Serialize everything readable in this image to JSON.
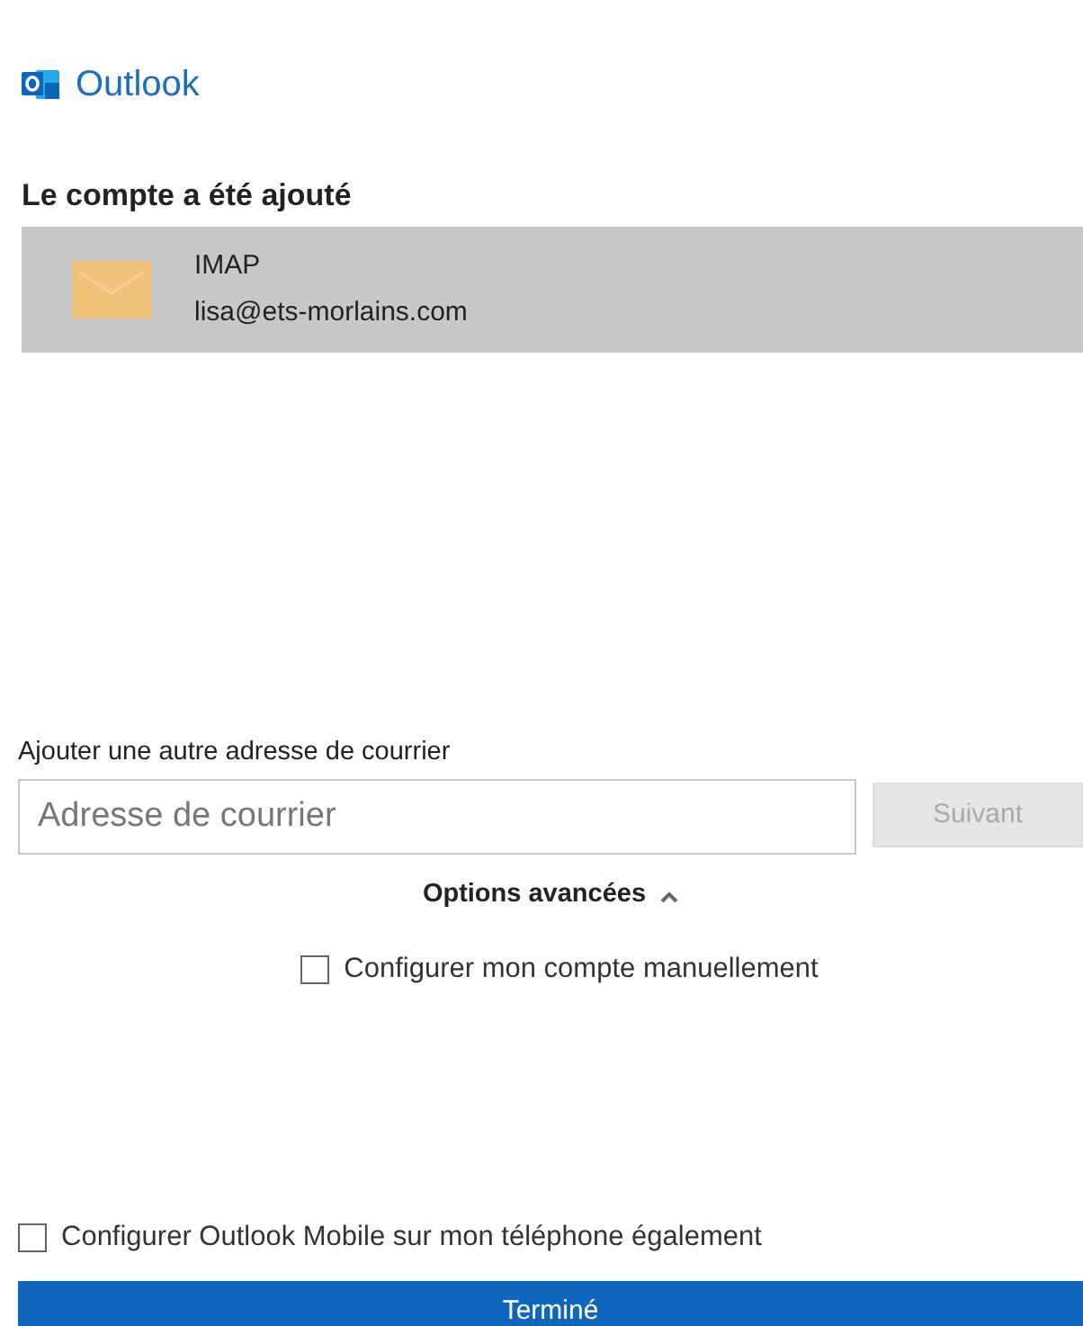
{
  "app": {
    "title": "Outlook"
  },
  "heading": "Le compte a été ajouté",
  "accounts": [
    {
      "type": "IMAP",
      "email": "lisa@ets-morlains.com",
      "selected": true
    }
  ],
  "add_account": {
    "label": "Ajouter une autre adresse de courrier",
    "placeholder": "Adresse de courrier",
    "next_button": {
      "label": "Suivant",
      "disabled": true
    }
  },
  "advanced": {
    "label": "Options avancées",
    "expanded": true,
    "options": [
      {
        "label": "Configurer mon compte manuellement",
        "checked": false
      }
    ]
  },
  "mobile_option": {
    "label": "Configurer Outlook Mobile sur mon téléphone également",
    "checked": false
  },
  "done_button": "Terminé"
}
